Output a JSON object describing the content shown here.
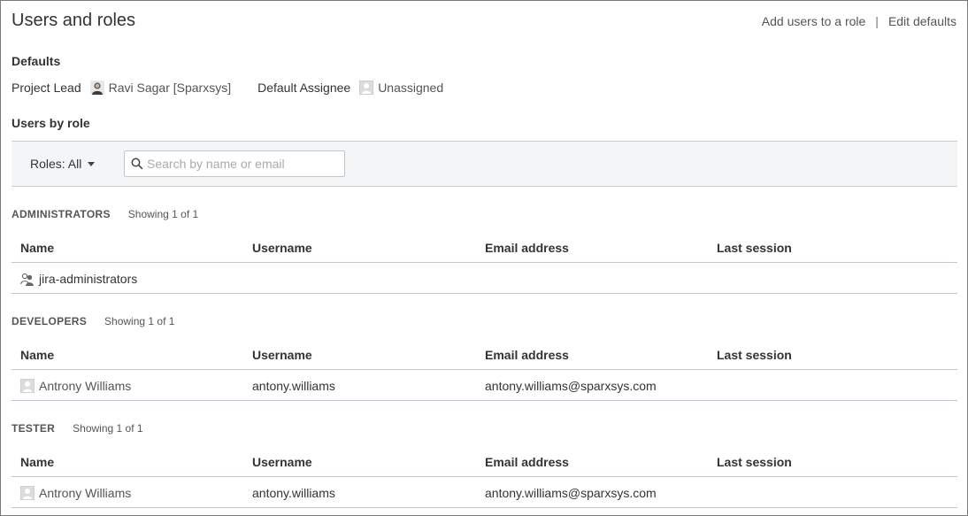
{
  "page": {
    "title": "Users and roles",
    "actions": {
      "add_users_label": "Add users to a role",
      "separator": "|",
      "edit_defaults_label": "Edit defaults"
    }
  },
  "defaults": {
    "heading": "Defaults",
    "project_lead_label": "Project Lead",
    "project_lead_value": "Ravi Sagar [Sparxsys]",
    "default_assignee_label": "Default Assignee",
    "default_assignee_value": "Unassigned"
  },
  "users_by_role": {
    "heading": "Users by role",
    "roles_filter": "Roles: All",
    "search_placeholder": "Search by name or email"
  },
  "columns": [
    "Name",
    "Username",
    "Email address",
    "Last session"
  ],
  "roles": [
    {
      "name": "ADMINISTRATORS",
      "showing": "Showing 1 of 1",
      "rows": [
        {
          "type": "group",
          "name": "jira-administrators",
          "username": "",
          "email": "",
          "last_session": ""
        }
      ]
    },
    {
      "name": "DEVELOPERS",
      "showing": "Showing 1 of 1",
      "rows": [
        {
          "type": "user",
          "name": "Antrony Williams",
          "username": "antony.williams",
          "email": "antony.williams@sparxsys.com",
          "last_session": ""
        }
      ]
    },
    {
      "name": "TESTER",
      "showing": "Showing 1 of 1",
      "rows": [
        {
          "type": "user",
          "name": "Antrony Williams",
          "username": "antony.williams",
          "email": "antony.williams@sparxsys.com",
          "last_session": ""
        }
      ]
    }
  ],
  "icons": {
    "lead_avatar": "user-avatar-icon",
    "assignee_avatar": "default-avatar-icon",
    "search": "search-icon",
    "caret": "chevron-down-icon",
    "group": "group-icon",
    "user": "user-avatar-icon"
  }
}
